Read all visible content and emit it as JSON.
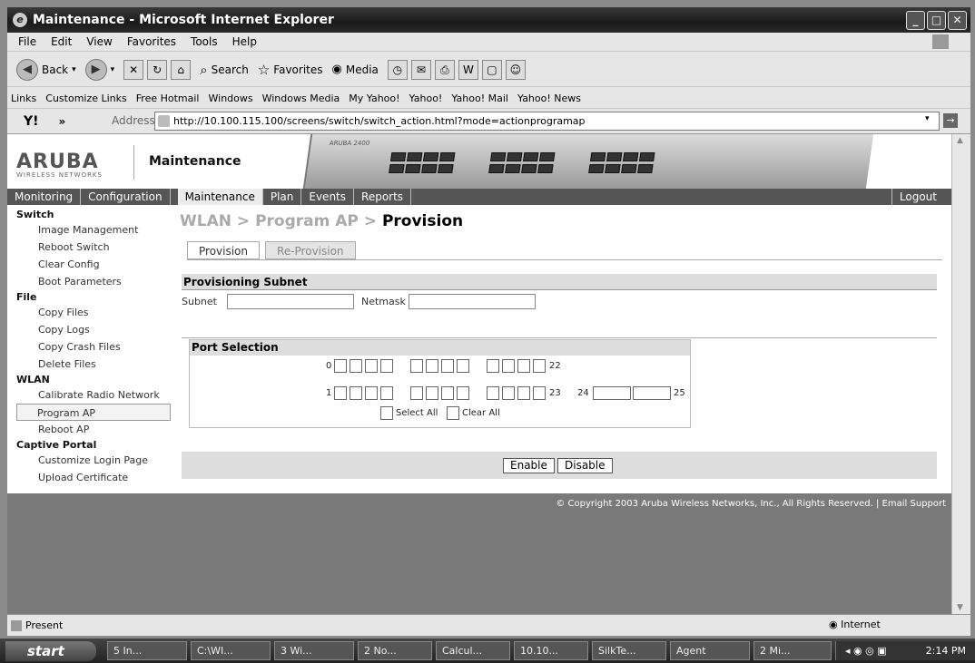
{
  "window": {
    "title": "Maintenance - Microsoft Internet Explorer"
  },
  "menubar": {
    "items": [
      "File",
      "Edit",
      "View",
      "Favorites",
      "Tools",
      "Help"
    ]
  },
  "toolbar": {
    "back": "Back",
    "search": "Search",
    "favorites": "Favorites",
    "media": "Media"
  },
  "links": {
    "label": "Links",
    "items": [
      "Customize Links",
      "Free Hotmail",
      "Windows",
      "Windows Media",
      "My Yahoo!",
      "Yahoo!",
      "Yahoo! Mail",
      "Yahoo! News"
    ]
  },
  "address": {
    "label": "Address",
    "url": "http://10.100.115.100/screens/switch/switch_action.html?mode=actionprogramap",
    "go": "Go"
  },
  "header": {
    "logo": "ARUBA",
    "logo_sub": "WIRELESS NETWORKS",
    "title": "Maintenance",
    "device_label": "ARUBA 2400"
  },
  "nav": {
    "tabs": [
      "Monitoring",
      "Configuration",
      "Maintenance",
      "Plan",
      "Events",
      "Reports"
    ],
    "active": "Maintenance",
    "logout": "Logout"
  },
  "sidebar": {
    "sections": [
      {
        "title": "Switch",
        "items": [
          "Image Management",
          "Reboot Switch",
          "Clear Config",
          "Boot Parameters"
        ]
      },
      {
        "title": "File",
        "items": [
          "Copy Files",
          "Copy Logs",
          "Copy Crash Files",
          "Delete Files"
        ]
      },
      {
        "title": "WLAN",
        "items": [
          "Calibrate Radio Network",
          "Program AP",
          "Reboot AP"
        ]
      },
      {
        "title": "Captive Portal",
        "items": [
          "Customize Login Page",
          "Upload Certificate"
        ]
      }
    ],
    "selected": "Program AP"
  },
  "content": {
    "breadcrumb_1": "WLAN",
    "breadcrumb_sep": ">",
    "breadcrumb_2": "Program AP",
    "breadcrumb_3": "Provision",
    "tabs": [
      "Provision",
      "Re-Provision"
    ],
    "provisioning_title": "Provisioning Subnet",
    "subnet_label": "Subnet",
    "subnet_value": "",
    "netmask_label": "Netmask",
    "netmask_value": "",
    "port_selection_title": "Port Selection",
    "row1_start": "0",
    "row1_end": "22",
    "row2_start": "1",
    "row2_end": "23",
    "extra_start": "24",
    "extra_end": "25",
    "select_all": "Select All",
    "clear_all": "Clear All",
    "enable": "Enable",
    "disable": "Disable"
  },
  "footer": {
    "copyright": "© Copyright 2003 Aruba Wireless Networks, Inc., All Rights Reserved. | Email Support"
  },
  "status": {
    "text": "Present",
    "zone": "Internet"
  },
  "taskbar": {
    "start": "start",
    "tasks": [
      "5 In...",
      "C:\\WI...",
      "3 Wi...",
      "2 No...",
      "Calcul...",
      "10.10...",
      "SilkTe...",
      "Agent",
      "2 Mi..."
    ],
    "clock": "2:14 PM"
  }
}
